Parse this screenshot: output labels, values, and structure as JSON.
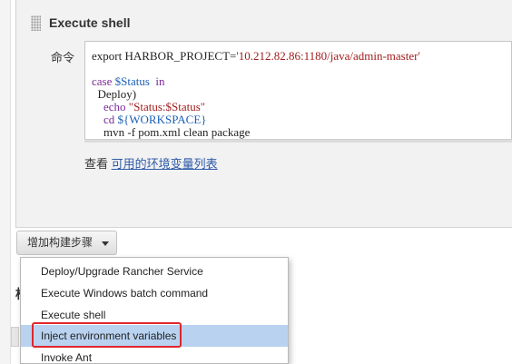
{
  "section": {
    "title": "Execute shell",
    "command_label": "命令",
    "code_lines": [
      [
        {
          "t": "export HARBOR_PROJECT=",
          "c": ""
        },
        {
          "t": "'10.212.82.86:1180/java/admin-master'",
          "c": "str"
        }
      ],
      [
        {
          "t": "",
          "c": ""
        }
      ],
      [
        {
          "t": "case ",
          "c": "kw"
        },
        {
          "t": "$Status",
          "c": "var"
        },
        {
          "t": "  in",
          "c": "kw"
        }
      ],
      [
        {
          "t": "  Deploy)",
          "c": ""
        }
      ],
      [
        {
          "t": "    echo ",
          "c": "kw"
        },
        {
          "t": "\"Status:$Status\"",
          "c": "str"
        }
      ],
      [
        {
          "t": "    cd ",
          "c": "kw"
        },
        {
          "t": "${WORKSPACE}",
          "c": "var"
        }
      ],
      [
        {
          "t": "    mvn -f pom.xml clean package",
          "c": ""
        }
      ]
    ],
    "env_prefix": "查看 ",
    "env_link": "可用的环境变量列表"
  },
  "add_step_button": {
    "label": "增加构建步骤"
  },
  "background": {
    "fragment": "构"
  },
  "dropdown": {
    "items": [
      {
        "label": "Deploy/Upgrade Rancher Service",
        "hover": false
      },
      {
        "label": "Execute Windows batch command",
        "hover": false
      },
      {
        "label": "Execute shell",
        "hover": false
      },
      {
        "label": "Inject environment variables",
        "hover": true
      },
      {
        "label": "Invoke Ant",
        "hover": false
      }
    ],
    "highlight_color": "#e0262a",
    "hover_color": "#b8d2f0"
  }
}
